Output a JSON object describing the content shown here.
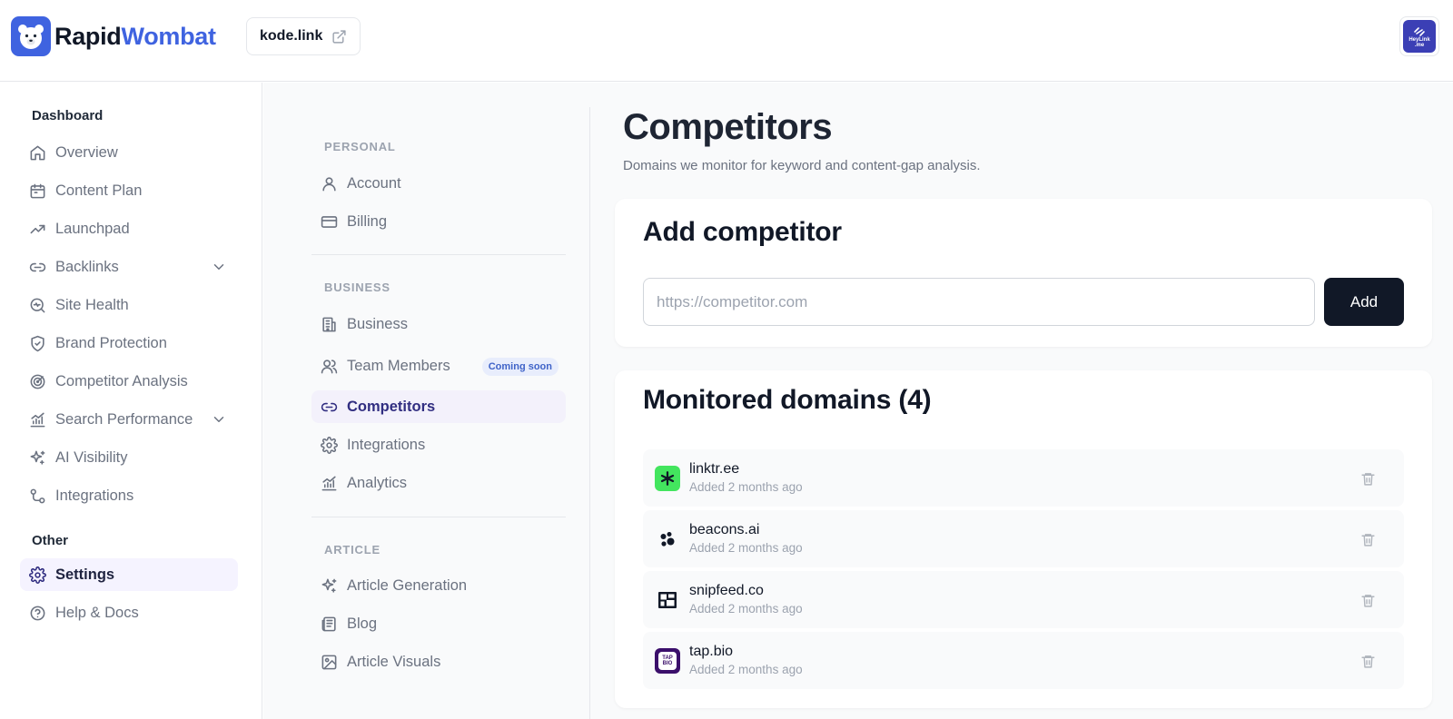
{
  "brand": {
    "name_part1": "Rapid",
    "name_part2": "Wombat",
    "accent_color": "#3f63e0",
    "logo_icon": "bear-logo-icon"
  },
  "header": {
    "site_name": "kode.link",
    "site_link_icon": "external-link-icon",
    "avatar_text_line1": "HeyLink",
    "avatar_text_line2": ".me"
  },
  "sidebar": {
    "dashboard_label": "Dashboard",
    "items": [
      {
        "label": "Overview",
        "icon": "home-icon"
      },
      {
        "label": "Content Plan",
        "icon": "calendar-icon"
      },
      {
        "label": "Launchpad",
        "icon": "trending-up-icon"
      },
      {
        "label": "Backlinks",
        "icon": "link-icon"
      },
      {
        "label": "Site Health",
        "icon": "search-health-icon"
      },
      {
        "label": "Brand Protection",
        "icon": "shield-icon"
      },
      {
        "label": "Competitor Analysis",
        "icon": "radar-icon"
      },
      {
        "label": "Search Performance",
        "icon": "bar-chart-icon"
      },
      {
        "label": "AI Visibility",
        "icon": "sparkles-icon"
      },
      {
        "label": "Integrations",
        "icon": "workflow-icon"
      }
    ],
    "other_label": "Other",
    "other_items": [
      {
        "label": "Settings",
        "icon": "gear-icon"
      },
      {
        "label": "Help & Docs",
        "icon": "help-circle-icon"
      }
    ]
  },
  "settings_nav": {
    "personal_label": "PERSONAL",
    "personal": [
      {
        "label": "Account",
        "icon": "user-icon"
      },
      {
        "label": "Billing",
        "icon": "credit-card-icon"
      }
    ],
    "business_label": "BUSINESS",
    "business": [
      {
        "label": "Business",
        "icon": "building-icon"
      },
      {
        "label": "Team Members",
        "icon": "users-icon",
        "badge": "Coming soon"
      },
      {
        "label": "Competitors",
        "icon": "link-icon"
      },
      {
        "label": "Integrations",
        "icon": "gear-icon"
      },
      {
        "label": "Analytics",
        "icon": "bar-chart-icon"
      }
    ],
    "article_label": "ARTICLE",
    "article": [
      {
        "label": "Article Generation",
        "icon": "sparkles-icon"
      },
      {
        "label": "Blog",
        "icon": "newspaper-icon"
      },
      {
        "label": "Article Visuals",
        "icon": "image-icon"
      }
    ]
  },
  "main": {
    "title": "Competitors",
    "subtitle": "Domains we monitor for keyword and content-gap analysis.",
    "add_card": {
      "title": "Add competitor",
      "input_placeholder": "https://competitor.com",
      "input_value": "",
      "button_label": "Add"
    },
    "list_card": {
      "title": "Monitored domains (4)",
      "domains": [
        {
          "name": "linktr.ee",
          "added": "Added 2 months ago",
          "icon": "linktree-logo-icon"
        },
        {
          "name": "beacons.ai",
          "added": "Added 2 months ago",
          "icon": "beacons-logo-icon"
        },
        {
          "name": "snipfeed.co",
          "added": "Added 2 months ago",
          "icon": "snipfeed-logo-icon"
        },
        {
          "name": "tap.bio",
          "added": "Added 2 months ago",
          "icon": "tapbio-logo-icon",
          "logo_text_line1": "TAP",
          "logo_text_line2": "BIO"
        }
      ],
      "delete_icon": "trash-icon"
    }
  }
}
